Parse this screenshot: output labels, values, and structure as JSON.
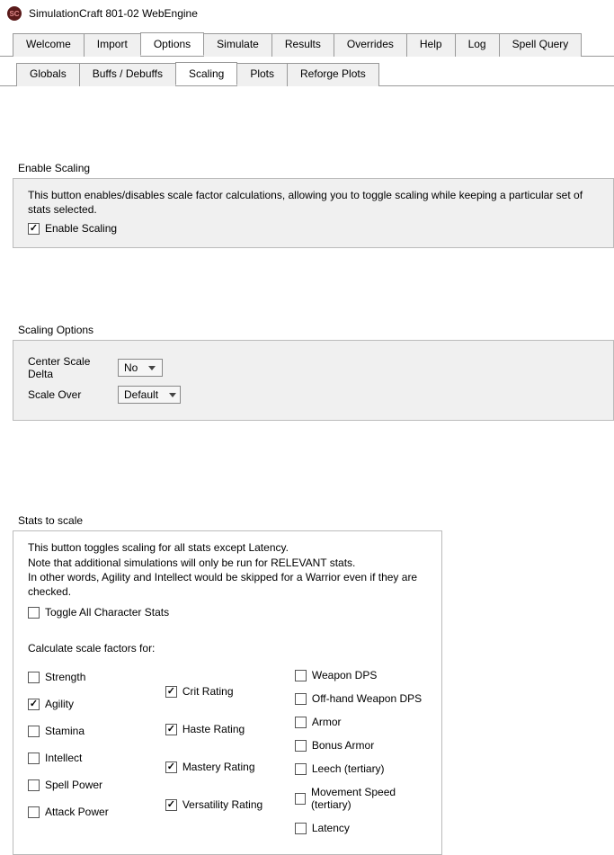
{
  "window": {
    "title": "SimulationCraft 801-02 WebEngine"
  },
  "tabs": {
    "main": [
      "Welcome",
      "Import",
      "Options",
      "Simulate",
      "Results",
      "Overrides",
      "Help",
      "Log",
      "Spell Query"
    ],
    "main_active": 2,
    "sub": [
      "Globals",
      "Buffs / Debuffs",
      "Scaling",
      "Plots",
      "Reforge Plots"
    ],
    "sub_active": 2
  },
  "enable_scaling": {
    "title": "Enable Scaling",
    "desc": "This button enables/disables scale factor calculations, allowing you to toggle scaling while keeping a particular set of stats selected.",
    "checkbox_label": "Enable Scaling",
    "checked": true
  },
  "scaling_options": {
    "title": "Scaling Options",
    "center_label": "Center Scale Delta",
    "center_value": "No",
    "scale_over_label": "Scale Over",
    "scale_over_value": "Default"
  },
  "stats_to_scale": {
    "title": "Stats to scale",
    "desc_l1": "This button toggles scaling for all stats except Latency.",
    "desc_l2": "Note that additional simulations will only be run for RELEVANT stats.",
    "desc_l3": "In other words, Agility and Intellect would be skipped for a Warrior even if they are checked.",
    "toggle_all_label": "Toggle All Character Stats",
    "toggle_all_checked": false,
    "calc_header": "Calculate scale factors for:",
    "col1": [
      {
        "label": "Strength",
        "checked": false
      },
      {
        "label": "Agility",
        "checked": true
      },
      {
        "label": "Stamina",
        "checked": false
      },
      {
        "label": "Intellect",
        "checked": false
      },
      {
        "label": "Spell Power",
        "checked": false
      },
      {
        "label": "Attack Power",
        "checked": false
      }
    ],
    "col2": [
      {
        "label": "Crit Rating",
        "checked": true
      },
      {
        "label": "Haste Rating",
        "checked": true
      },
      {
        "label": "Mastery Rating",
        "checked": true
      },
      {
        "label": "Versatility Rating",
        "checked": true
      }
    ],
    "col3": [
      {
        "label": "Weapon DPS",
        "checked": false
      },
      {
        "label": "Off-hand Weapon DPS",
        "checked": false
      },
      {
        "label": "Armor",
        "checked": false
      },
      {
        "label": "Bonus Armor",
        "checked": false
      },
      {
        "label": "Leech (tertiary)",
        "checked": false
      },
      {
        "label": "Movement Speed (tertiary)",
        "checked": false
      },
      {
        "label": "Latency",
        "checked": false
      }
    ]
  }
}
